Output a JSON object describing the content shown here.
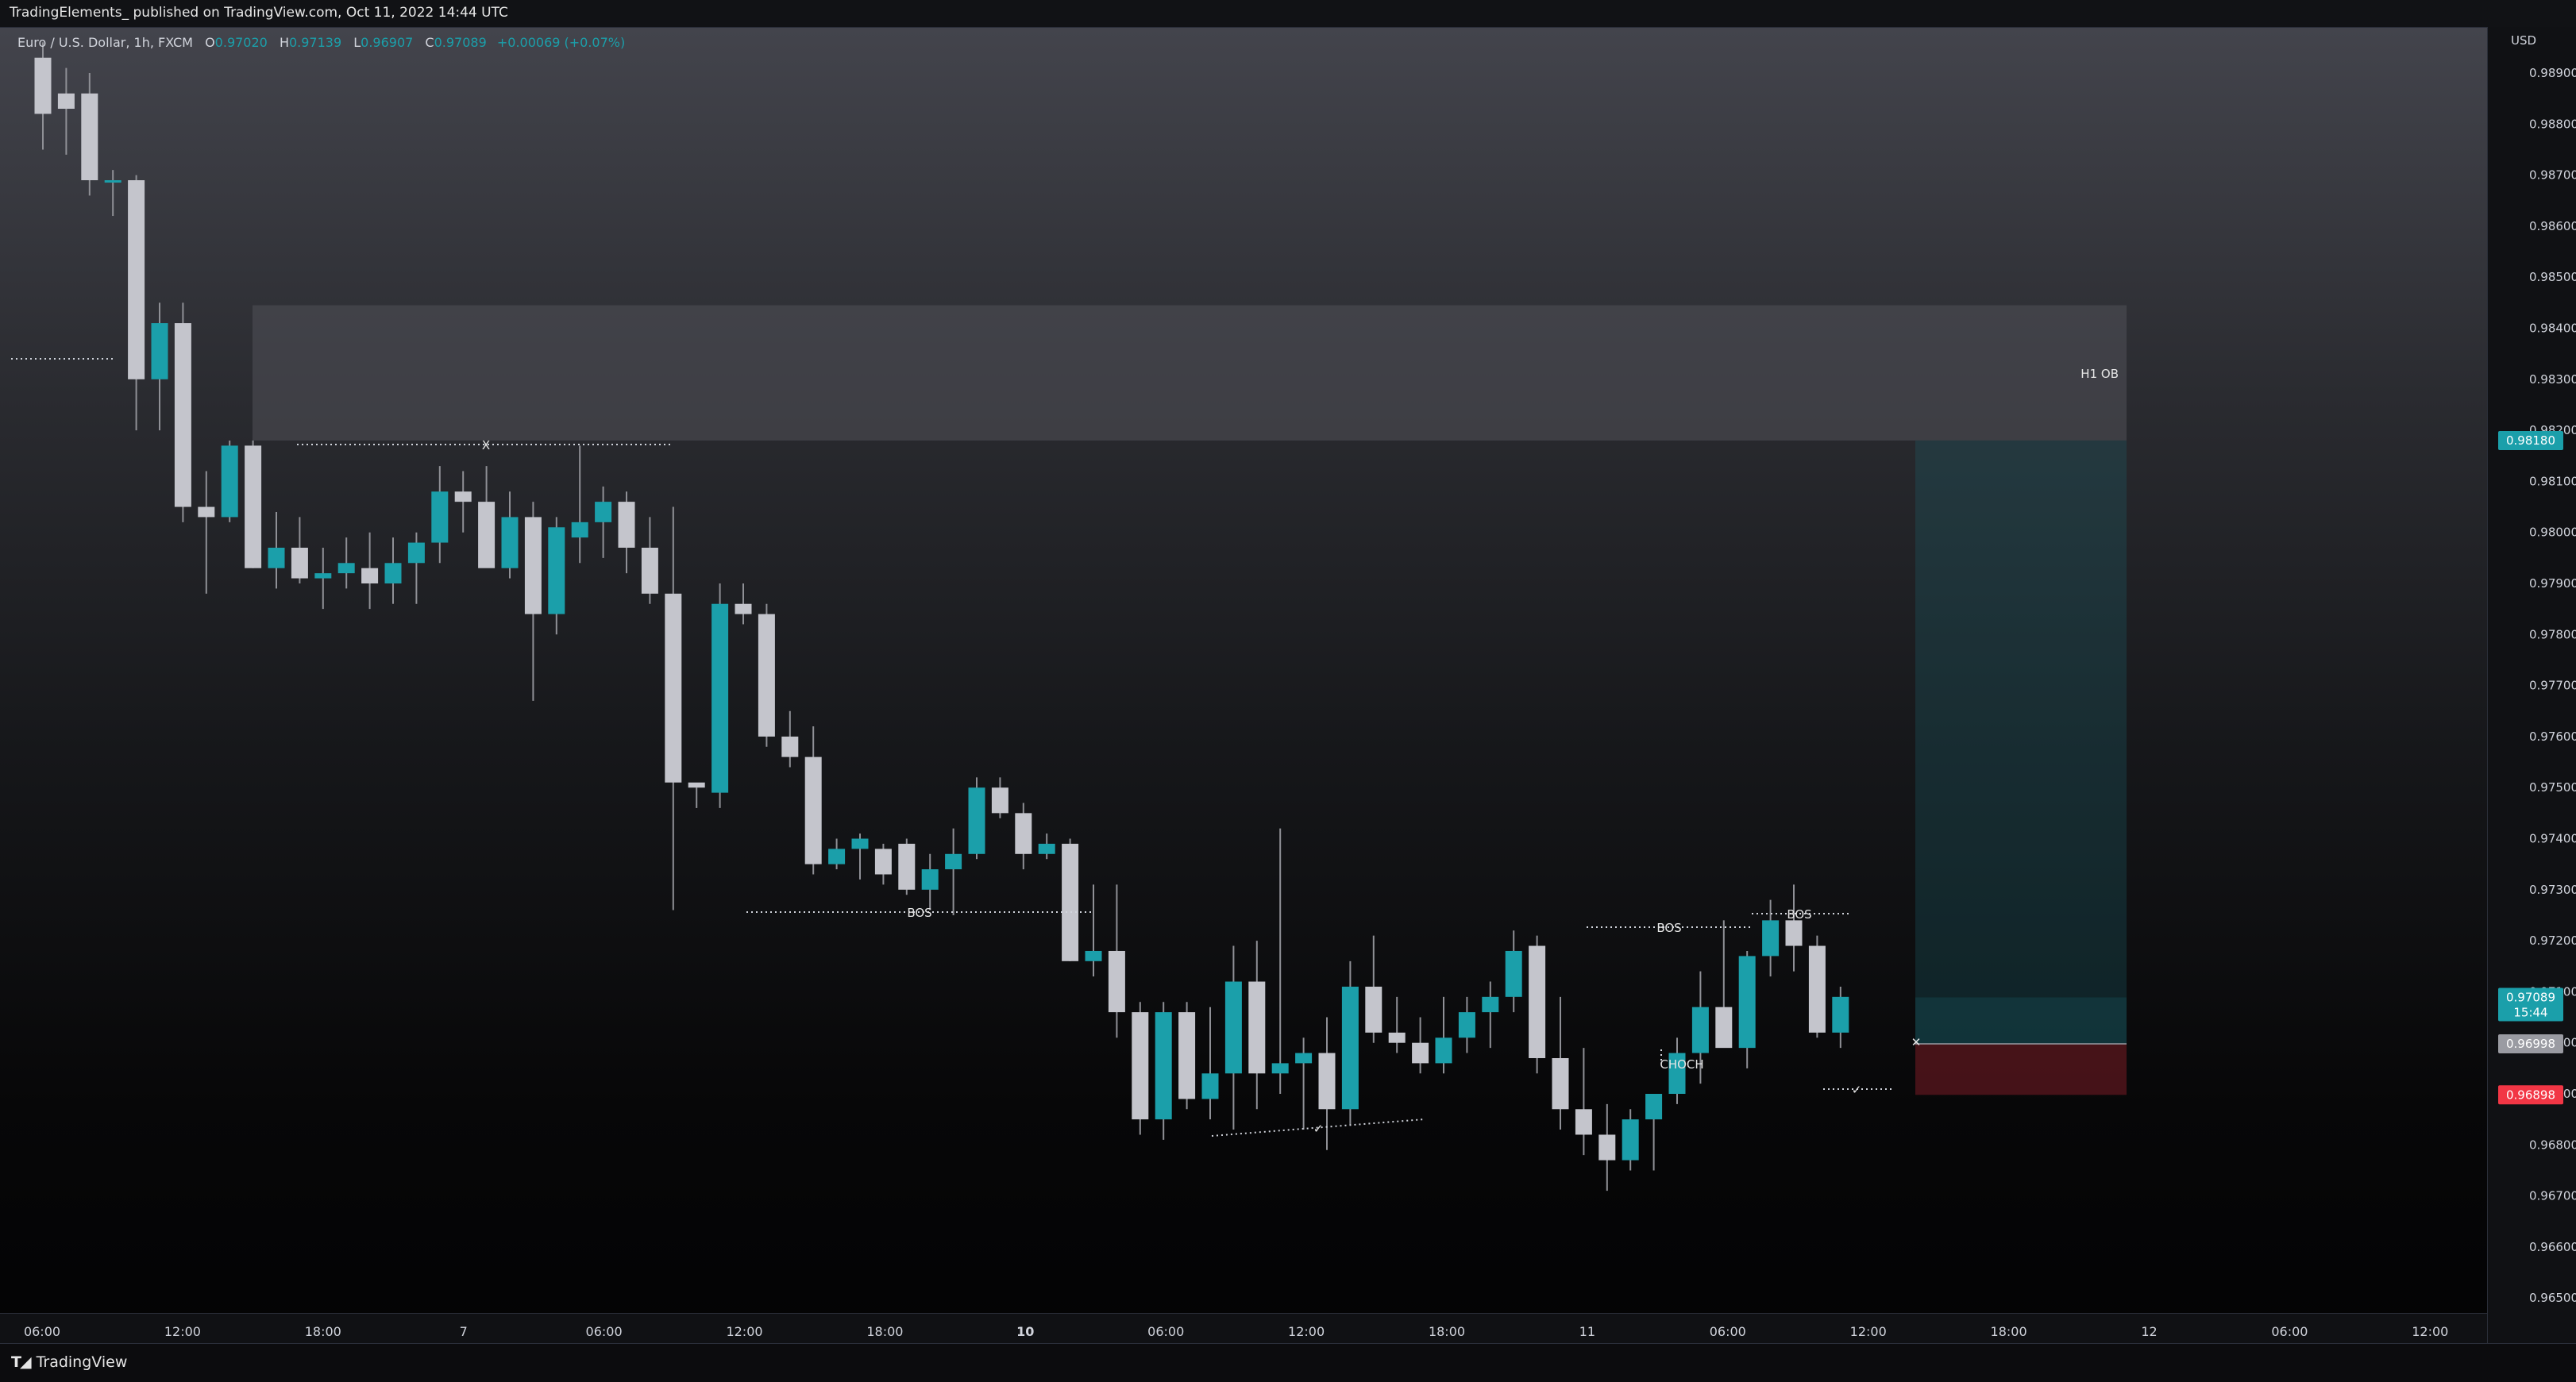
{
  "header": {
    "publish_text": "TradingElements_ published on TradingView.com, Oct 11, 2022 14:44 UTC"
  },
  "legend": {
    "symbol": "Euro / U.S. Dollar, 1h, FXCM",
    "open_label": "O",
    "open": "0.97020",
    "high_label": "H",
    "high": "0.97139",
    "low_label": "L",
    "low": "0.96907",
    "close_label": "C",
    "close": "0.97089",
    "change": "+0.00069 (+0.07%)"
  },
  "price_axis": {
    "currency": "USD",
    "ticks": [
      "0.98900",
      "0.98800",
      "0.98700",
      "0.98600",
      "0.98500",
      "0.98400",
      "0.98300",
      "0.98200",
      "0.98100",
      "0.98000",
      "0.97900",
      "0.97800",
      "0.97700",
      "0.97600",
      "0.97500",
      "0.97400",
      "0.97300",
      "0.97200",
      "0.97100",
      "0.97000",
      "0.96900",
      "0.96800",
      "0.96700",
      "0.96600",
      "0.96500"
    ],
    "badges": [
      {
        "text": "0.98180",
        "price": 0.9818,
        "color": "#1b9faa"
      },
      {
        "text": "0.97089",
        "sub": "15:44",
        "price": 0.97089,
        "color": "#1b9faa"
      },
      {
        "text": "0.96998",
        "price": 0.96998,
        "color": "#9a9ba2"
      },
      {
        "text": "0.96898",
        "price": 0.96898,
        "color": "#f23645"
      }
    ]
  },
  "time_axis": {
    "ticks": [
      {
        "label": "06:00",
        "bold": false
      },
      {
        "label": "12:00",
        "bold": false
      },
      {
        "label": "18:00",
        "bold": false
      },
      {
        "label": "7",
        "bold": false
      },
      {
        "label": "06:00",
        "bold": false
      },
      {
        "label": "12:00",
        "bold": false
      },
      {
        "label": "18:00",
        "bold": false
      },
      {
        "label": "10",
        "bold": true
      },
      {
        "label": "06:00",
        "bold": false
      },
      {
        "label": "12:00",
        "bold": false
      },
      {
        "label": "18:00",
        "bold": false
      },
      {
        "label": "11",
        "bold": false
      },
      {
        "label": "06:00",
        "bold": false
      },
      {
        "label": "12:00",
        "bold": false
      },
      {
        "label": "18:00",
        "bold": false
      },
      {
        "label": "12",
        "bold": false
      },
      {
        "label": "06:00",
        "bold": false
      },
      {
        "label": "12:00",
        "bold": false
      }
    ]
  },
  "annotations": {
    "h1_ob": "H1 OB",
    "bos": "BOS",
    "choch": "CHOCH",
    "x_mark": "X",
    "check": "✓",
    "cross": "✕"
  },
  "colors": {
    "bull": "#1b9faa",
    "bear": "#c4c5cc",
    "wick": "#8f9096",
    "ob_zone": "rgba(80,81,88,0.55)",
    "target_zone": "rgba(27,102,112,0.28)",
    "stop_zone": "rgba(120,28,36,0.55)"
  },
  "chart_data": {
    "type": "candlestick",
    "symbol": "Euro / U.S. Dollar",
    "interval": "1h",
    "ylim": [
      0.9645,
      0.9895
    ],
    "candles": [
      {
        "o": 0.9893,
        "h": 0.9896,
        "l": 0.9875,
        "c": 0.9882
      },
      {
        "o": 0.9886,
        "h": 0.9891,
        "l": 0.9874,
        "c": 0.9883
      },
      {
        "o": 0.9886,
        "h": 0.989,
        "l": 0.9866,
        "c": 0.9869
      },
      {
        "o": 0.9869,
        "h": 0.9871,
        "l": 0.9862,
        "c": 0.9869
      },
      {
        "o": 0.9869,
        "h": 0.987,
        "l": 0.982,
        "c": 0.983
      },
      {
        "o": 0.983,
        "h": 0.9845,
        "l": 0.982,
        "c": 0.9841
      },
      {
        "o": 0.9841,
        "h": 0.9845,
        "l": 0.9802,
        "c": 0.9805
      },
      {
        "o": 0.9805,
        "h": 0.9812,
        "l": 0.9788,
        "c": 0.9803
      },
      {
        "o": 0.9803,
        "h": 0.9818,
        "l": 0.9802,
        "c": 0.9817
      },
      {
        "o": 0.9817,
        "h": 0.9818,
        "l": 0.9793,
        "c": 0.9793
      },
      {
        "o": 0.9793,
        "h": 0.9804,
        "l": 0.9789,
        "c": 0.9797
      },
      {
        "o": 0.9797,
        "h": 0.9803,
        "l": 0.979,
        "c": 0.9791
      },
      {
        "o": 0.9791,
        "h": 0.9797,
        "l": 0.9785,
        "c": 0.9792
      },
      {
        "o": 0.9792,
        "h": 0.9799,
        "l": 0.9789,
        "c": 0.9794
      },
      {
        "o": 0.9793,
        "h": 0.98,
        "l": 0.9785,
        "c": 0.979
      },
      {
        "o": 0.979,
        "h": 0.9799,
        "l": 0.9786,
        "c": 0.9794
      },
      {
        "o": 0.9794,
        "h": 0.98,
        "l": 0.9786,
        "c": 0.9798
      },
      {
        "o": 0.9798,
        "h": 0.9813,
        "l": 0.9794,
        "c": 0.9808
      },
      {
        "o": 0.9808,
        "h": 0.9812,
        "l": 0.98,
        "c": 0.9806
      },
      {
        "o": 0.9806,
        "h": 0.9813,
        "l": 0.9795,
        "c": 0.9793
      },
      {
        "o": 0.9793,
        "h": 0.9808,
        "l": 0.9791,
        "c": 0.9803
      },
      {
        "o": 0.9803,
        "h": 0.9806,
        "l": 0.9767,
        "c": 0.9784
      },
      {
        "o": 0.9784,
        "h": 0.9803,
        "l": 0.978,
        "c": 0.9801
      },
      {
        "o": 0.9799,
        "h": 0.9817,
        "l": 0.9794,
        "c": 0.9802
      },
      {
        "o": 0.9802,
        "h": 0.9809,
        "l": 0.9795,
        "c": 0.9806
      },
      {
        "o": 0.9806,
        "h": 0.9808,
        "l": 0.9792,
        "c": 0.9797
      },
      {
        "o": 0.9797,
        "h": 0.9803,
        "l": 0.9786,
        "c": 0.9788
      },
      {
        "o": 0.9788,
        "h": 0.9805,
        "l": 0.9726,
        "c": 0.9751
      },
      {
        "o": 0.9751,
        "h": 0.975,
        "l": 0.9746,
        "c": 0.975
      },
      {
        "o": 0.9749,
        "h": 0.979,
        "l": 0.9746,
        "c": 0.9786
      },
      {
        "o": 0.9786,
        "h": 0.979,
        "l": 0.9782,
        "c": 0.9784
      },
      {
        "o": 0.9784,
        "h": 0.9786,
        "l": 0.9758,
        "c": 0.976
      },
      {
        "o": 0.976,
        "h": 0.9765,
        "l": 0.9754,
        "c": 0.9756
      },
      {
        "o": 0.9756,
        "h": 0.9762,
        "l": 0.9733,
        "c": 0.9735
      },
      {
        "o": 0.9735,
        "h": 0.974,
        "l": 0.9734,
        "c": 0.9738
      },
      {
        "o": 0.9738,
        "h": 0.9741,
        "l": 0.9732,
        "c": 0.974
      },
      {
        "o": 0.9738,
        "h": 0.9739,
        "l": 0.9731,
        "c": 0.9733
      },
      {
        "o": 0.9739,
        "h": 0.974,
        "l": 0.9729,
        "c": 0.973
      },
      {
        "o": 0.973,
        "h": 0.9737,
        "l": 0.9726,
        "c": 0.9734
      },
      {
        "o": 0.9734,
        "h": 0.9742,
        "l": 0.9725,
        "c": 0.9737
      },
      {
        "o": 0.9737,
        "h": 0.9752,
        "l": 0.9736,
        "c": 0.975
      },
      {
        "o": 0.975,
        "h": 0.9752,
        "l": 0.9744,
        "c": 0.9745
      },
      {
        "o": 0.9745,
        "h": 0.9747,
        "l": 0.9734,
        "c": 0.9737
      },
      {
        "o": 0.9737,
        "h": 0.9741,
        "l": 0.9736,
        "c": 0.9739
      },
      {
        "o": 0.9739,
        "h": 0.974,
        "l": 0.9716,
        "c": 0.9716
      },
      {
        "o": 0.9716,
        "h": 0.9731,
        "l": 0.9713,
        "c": 0.9718
      },
      {
        "o": 0.9718,
        "h": 0.9731,
        "l": 0.9701,
        "c": 0.9706
      },
      {
        "o": 0.9706,
        "h": 0.9708,
        "l": 0.9682,
        "c": 0.9685
      },
      {
        "o": 0.9685,
        "h": 0.9708,
        "l": 0.9681,
        "c": 0.9706
      },
      {
        "o": 0.9706,
        "h": 0.9708,
        "l": 0.9687,
        "c": 0.9689
      },
      {
        "o": 0.9689,
        "h": 0.9707,
        "l": 0.9685,
        "c": 0.9694
      },
      {
        "o": 0.9694,
        "h": 0.9719,
        "l": 0.9683,
        "c": 0.9712
      },
      {
        "o": 0.9712,
        "h": 0.972,
        "l": 0.9687,
        "c": 0.9694
      },
      {
        "o": 0.9694,
        "h": 0.9742,
        "l": 0.969,
        "c": 0.9696
      },
      {
        "o": 0.9696,
        "h": 0.9701,
        "l": 0.9683,
        "c": 0.9698
      },
      {
        "o": 0.9698,
        "h": 0.9705,
        "l": 0.9679,
        "c": 0.9687
      },
      {
        "o": 0.9687,
        "h": 0.9716,
        "l": 0.9684,
        "c": 0.9711
      },
      {
        "o": 0.9711,
        "h": 0.9721,
        "l": 0.97,
        "c": 0.9702
      },
      {
        "o": 0.9702,
        "h": 0.9709,
        "l": 0.9698,
        "c": 0.97
      },
      {
        "o": 0.97,
        "h": 0.9705,
        "l": 0.9694,
        "c": 0.9696
      },
      {
        "o": 0.9696,
        "h": 0.9709,
        "l": 0.9694,
        "c": 0.9701
      },
      {
        "o": 0.9701,
        "h": 0.9709,
        "l": 0.9698,
        "c": 0.9706
      },
      {
        "o": 0.9706,
        "h": 0.9712,
        "l": 0.9699,
        "c": 0.9709
      },
      {
        "o": 0.9709,
        "h": 0.9722,
        "l": 0.9706,
        "c": 0.9718
      },
      {
        "o": 0.9719,
        "h": 0.9721,
        "l": 0.9694,
        "c": 0.9697
      },
      {
        "o": 0.9697,
        "h": 0.9709,
        "l": 0.9683,
        "c": 0.9687
      },
      {
        "o": 0.9687,
        "h": 0.9699,
        "l": 0.9678,
        "c": 0.9682
      },
      {
        "o": 0.9682,
        "h": 0.9688,
        "l": 0.9671,
        "c": 0.9677
      },
      {
        "o": 0.9677,
        "h": 0.9687,
        "l": 0.9675,
        "c": 0.9685
      },
      {
        "o": 0.9685,
        "h": 0.9689,
        "l": 0.9675,
        "c": 0.969
      },
      {
        "o": 0.969,
        "h": 0.9701,
        "l": 0.9688,
        "c": 0.9698
      },
      {
        "o": 0.9698,
        "h": 0.9714,
        "l": 0.9692,
        "c": 0.9707
      },
      {
        "o": 0.9707,
        "h": 0.9724,
        "l": 0.97,
        "c": 0.9699
      },
      {
        "o": 0.9699,
        "h": 0.9718,
        "l": 0.9695,
        "c": 0.9717
      },
      {
        "o": 0.9717,
        "h": 0.9728,
        "l": 0.9713,
        "c": 0.9724
      },
      {
        "o": 0.9724,
        "h": 0.9731,
        "l": 0.9714,
        "c": 0.9719
      },
      {
        "o": 0.9719,
        "h": 0.9721,
        "l": 0.9701,
        "c": 0.9702
      },
      {
        "o": 0.9702,
        "h": 0.9711,
        "l": 0.9699,
        "c": 0.9709
      }
    ]
  }
}
